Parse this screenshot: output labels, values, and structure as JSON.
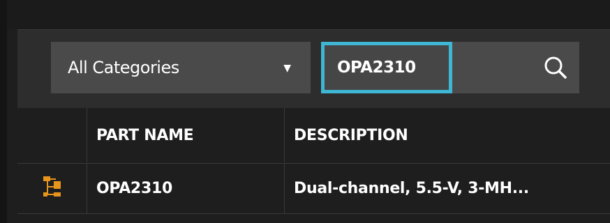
{
  "toolbar": {
    "category": {
      "selected": "All Categories",
      "arrow": "▼"
    },
    "search": {
      "value": "OPA2310",
      "icon": "search-icon",
      "focus_color": "#3fb6d4"
    }
  },
  "table": {
    "columns": [
      "",
      "PART NAME",
      "DESCRIPTION"
    ],
    "rows": [
      {
        "icon": "hierarchy-icon",
        "part_name": "OPA2310",
        "description": "Dual-channel, 5.5-V, 3-MH..."
      }
    ],
    "icon_color": "#e8951d"
  }
}
